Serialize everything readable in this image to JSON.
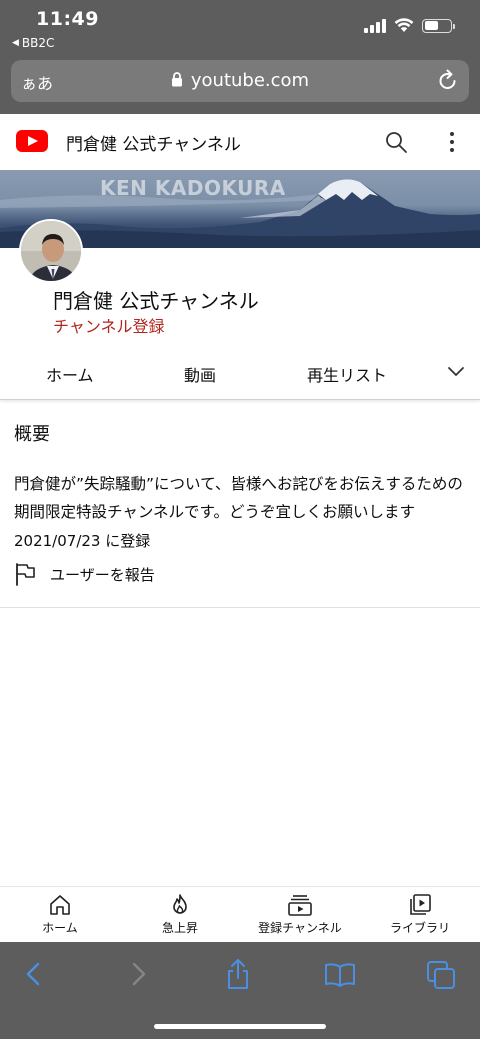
{
  "status_bar": {
    "time": "11:49",
    "back_app": "BB2C"
  },
  "browser": {
    "text_size_button": "ぁあ",
    "url": "youtube.com",
    "lock_icon": "lock-icon",
    "reload_icon": "reload-icon"
  },
  "header": {
    "logo_icon": "youtube-logo-icon",
    "title": "門倉健 公式チャンネル",
    "search_icon": "search-icon",
    "more_icon": "more-vert-icon"
  },
  "banner": {
    "text": "KEN KADOKURA"
  },
  "channel": {
    "name": "門倉健 公式チャンネル",
    "subscribe_label": "チャンネル登録"
  },
  "tabs": [
    {
      "label": "ホーム"
    },
    {
      "label": "動画"
    },
    {
      "label": "再生リスト"
    }
  ],
  "about": {
    "heading": "概要",
    "description": "門倉健が”失踪騒動”について、皆様へお詫びをお伝えするための期間限定特設チャンネルです。どうぞ宜しくお願いします",
    "joined": "2021/07/23 に登録",
    "report_label": "ユーザーを報告"
  },
  "bottom_nav": [
    {
      "label": "ホーム",
      "icon": "home-icon"
    },
    {
      "label": "急上昇",
      "icon": "trending-fire-icon"
    },
    {
      "label": "登録チャンネル",
      "icon": "subscriptions-icon"
    },
    {
      "label": "ライブラリ",
      "icon": "library-icon"
    }
  ],
  "colors": {
    "brand_red": "#ff0000",
    "subscribe_red": "#b3261e",
    "safari_chrome": "#5d5d5d",
    "ios_blue": "#4a90e2"
  }
}
